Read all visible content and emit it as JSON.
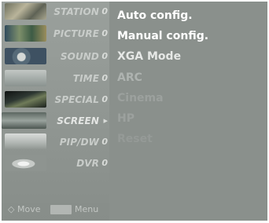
{
  "menu": {
    "items": [
      {
        "label": "STATION",
        "marker": "0"
      },
      {
        "label": "PICTURE",
        "marker": "0"
      },
      {
        "label": "SOUND",
        "marker": "0"
      },
      {
        "label": "TIME",
        "marker": "0"
      },
      {
        "label": "SPECIAL",
        "marker": "0"
      },
      {
        "label": "SCREEN",
        "marker": "▸"
      },
      {
        "label": "PIP/DW",
        "marker": "0"
      },
      {
        "label": "DVR",
        "marker": "0"
      }
    ]
  },
  "hints": {
    "move_label": "Move",
    "menu_label": "Menu"
  },
  "submenu": {
    "options": [
      {
        "label": "Auto config.",
        "color": "#ffffff"
      },
      {
        "label": "Manual config.",
        "color": "#ffffff"
      },
      {
        "label": "XGA Mode",
        "color": "#e6e8e6"
      },
      {
        "label": "ARC",
        "color": "#aeb3b0"
      },
      {
        "label": "Cinema",
        "color": "#9ca19e"
      },
      {
        "label": "HP",
        "color": "#9ca19e"
      },
      {
        "label": "Reset",
        "color": "#959a97"
      }
    ]
  }
}
